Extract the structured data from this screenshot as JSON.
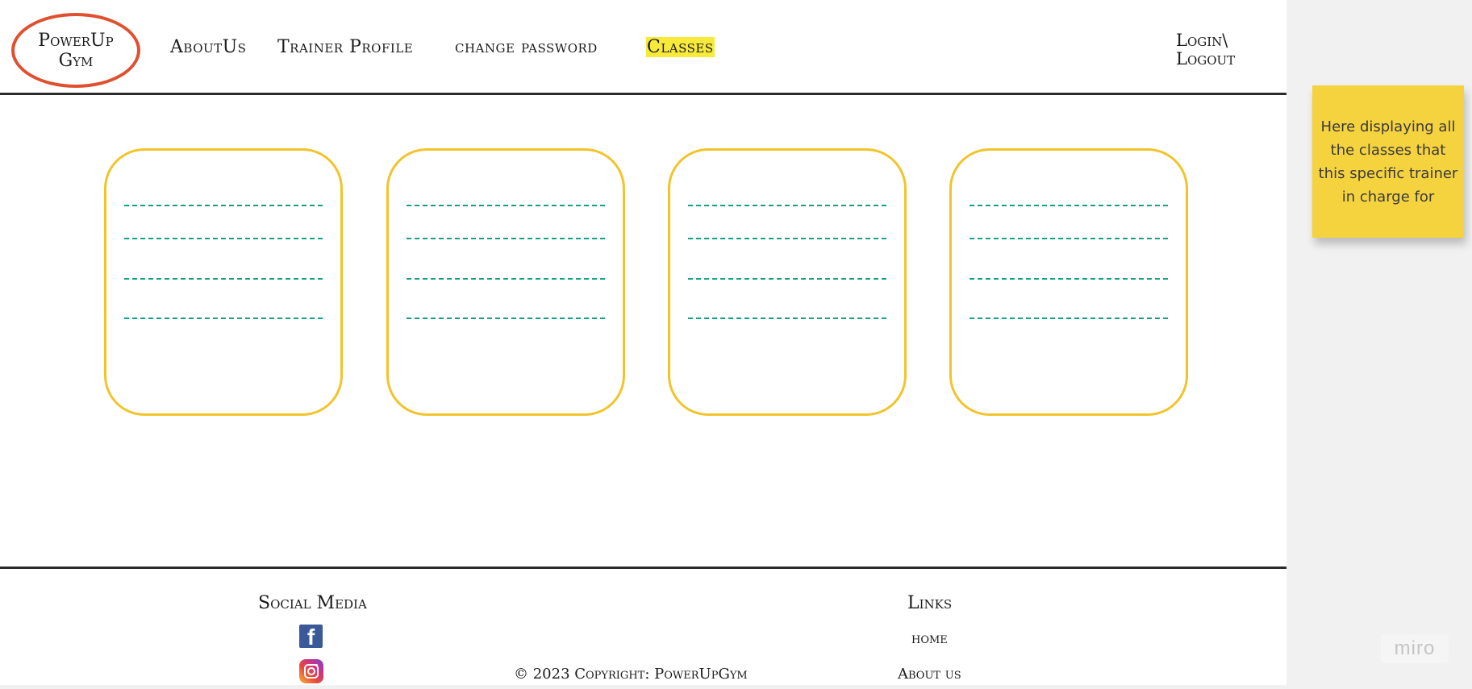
{
  "header": {
    "logo": "PowerUp\nGym",
    "nav": [
      "AboutUs",
      "Trainer Profile",
      "change password",
      "Classes"
    ],
    "active_nav": "Classes",
    "login": "Login\\\nLogout"
  },
  "class_cards": {
    "count": 4,
    "placeholder_lines_per_card": 4
  },
  "sticky_note": {
    "text": "Here displaying all the classes that this specific trainer in charge for"
  },
  "footer": {
    "social_title": "Social Media",
    "social_icons": [
      "facebook-icon",
      "instagram-icon"
    ],
    "links_title": "Links",
    "links": [
      "home",
      "About us"
    ],
    "copyright": "© 2023 Copyright: PowerUpGym"
  },
  "watermark": "miro",
  "colors": {
    "logo_ring": "#e0502f",
    "active_highlight": "#f7ea3a",
    "card_border": "#f2c42b",
    "placeholder_dash": "#14a083",
    "sticky_note": "#f5d33f"
  }
}
